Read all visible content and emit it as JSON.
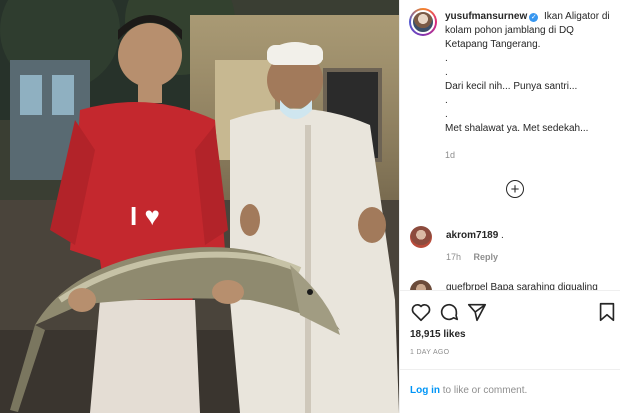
{
  "post": {
    "username": "yusufmansurnew",
    "verified_mark": "✓",
    "caption_lines": [
      "Ikan Aligator di kolam pohon jamblang di DQ Ketapang Tangerang.",
      ".",
      ".",
      "Dari kecil nih... Punya santri...",
      ".",
      ".",
      "Met shalawat ya. Met sedekah..."
    ],
    "time_ago": "1d"
  },
  "load_more_symbol": "+",
  "comments": [
    {
      "username": "akrom7189",
      "text": ".",
      "time": "17h",
      "reply_label": "Reply"
    }
  ],
  "partial_comment": {
    "text": "guefbrpel Bapa sarahing digualing"
  },
  "actions": {
    "likes": "18,915 likes",
    "date": "1 DAY AGO"
  },
  "login": {
    "link_text": "Log in",
    "rest_text": " to like or comment."
  },
  "icons": {
    "like": "heart-icon",
    "comment": "comment-bubble-icon",
    "share": "paper-plane-icon",
    "save": "bookmark-icon",
    "load_more": "plus-circle-icon"
  },
  "colors": {
    "link": "#0095f6",
    "verified": "#3897f0",
    "muted": "#8e8e8e",
    "text": "#262626"
  }
}
